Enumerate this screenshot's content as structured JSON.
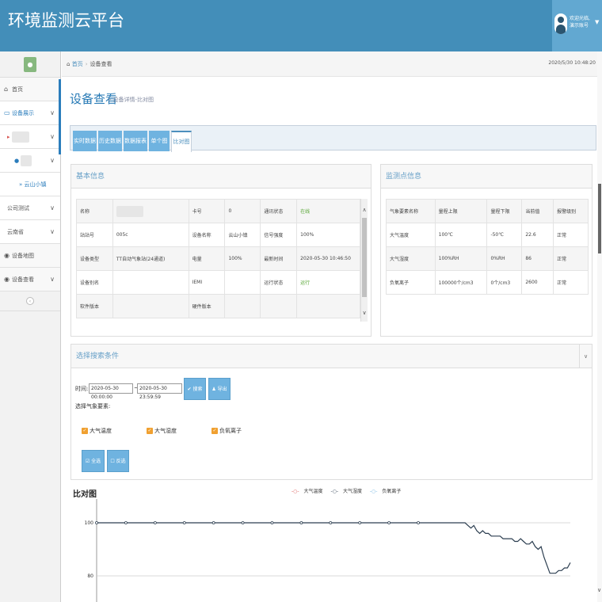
{
  "app": {
    "title": "环境监测云平台"
  },
  "user": {
    "welcome": "欢迎光临,",
    "name": "演示账号"
  },
  "breadcrumb": {
    "home": "首页",
    "current": "设备查看",
    "time": "2020/5/30 10:48:20"
  },
  "sidebar": {
    "items": [
      {
        "label": "首页",
        "icon": "home-icon"
      },
      {
        "label": "设备展示",
        "icon": "monitor-icon"
      },
      {
        "label": "公司测试"
      },
      {
        "label": "云南省"
      },
      {
        "label": "设备地图",
        "icon": "map-icon"
      },
      {
        "label": "设备查看",
        "icon": "eye-icon"
      }
    ],
    "leaf": "云山小镇"
  },
  "page": {
    "title": "设备查看",
    "subtitle": "设备详情-比对图"
  },
  "tabs": [
    "实时数据",
    "历史数据",
    "数据报表",
    "单个图",
    "比对图"
  ],
  "basic": {
    "title": "基本信息",
    "rows": [
      [
        "名称",
        "",
        "卡号",
        "0",
        "通讯状态",
        "在线"
      ],
      [
        "站站号",
        "005c",
        "设备名称",
        "云山小镇",
        "信号强度",
        "100%"
      ],
      [
        "设备类型",
        "TT自动气象站(24通道)",
        "电量",
        "100%",
        "最新时间",
        "2020-05-30 10:46:50"
      ],
      [
        "设备别名",
        "",
        "IEMI",
        "",
        "运行状态",
        "运行"
      ],
      [
        "软件版本",
        "",
        "硬件版本",
        "",
        "",
        ""
      ]
    ]
  },
  "monitor": {
    "title": "监测点信息",
    "headers": [
      "气象要素名称",
      "量程上限",
      "量程下限",
      "当前值",
      "报警级别"
    ],
    "rows": [
      [
        "大气温度",
        "100℃",
        "-50℃",
        "22.6",
        "正常"
      ],
      [
        "大气湿度",
        "100%RH",
        "0%RH",
        "86",
        "正常"
      ],
      [
        "负氧离子",
        "100000个/cm3",
        "0个/cm3",
        "2600",
        "正常"
      ]
    ]
  },
  "search": {
    "title": "选择搜索条件",
    "time_label": "时间:",
    "from": "2020-05-30 00:00:00",
    "to": "2020-05-30 23:59:59",
    "tilde": "~",
    "search_btn": "搜索",
    "export_btn": "导出",
    "elements_label": "选择气象要素:",
    "options": [
      "大气温度",
      "大气湿度",
      "负氧离子"
    ],
    "select_all": "全选",
    "reverse": "反选"
  },
  "chart_data": {
    "type": "line",
    "title": "比对图",
    "series": [
      {
        "name": "大气温度"
      },
      {
        "name": "大气湿度",
        "y": [
          100,
          100,
          100,
          100,
          100,
          100,
          100,
          100,
          100,
          100,
          100,
          100,
          100,
          100,
          100,
          100,
          100,
          100,
          100,
          100,
          100,
          100,
          100,
          100,
          100,
          100,
          100,
          100,
          100,
          100,
          100,
          100,
          100,
          100,
          100,
          100,
          100,
          100,
          100,
          100,
          100,
          100,
          100,
          100,
          100,
          100,
          100,
          100,
          100,
          100,
          100,
          100,
          100,
          100,
          100,
          100,
          100,
          100,
          100,
          100,
          100,
          100,
          100,
          100,
          100,
          100,
          100,
          100,
          100,
          100,
          100,
          100,
          100,
          100,
          100,
          100,
          100,
          100,
          100,
          100,
          100,
          100,
          100,
          100,
          100,
          100,
          100,
          100,
          100,
          100,
          100,
          100,
          100,
          100,
          100,
          100,
          100,
          100,
          100,
          100,
          100,
          100,
          100,
          100,
          100,
          100,
          100,
          100,
          100,
          100,
          100,
          100,
          100,
          100,
          100,
          100,
          100,
          100,
          100,
          100,
          100,
          100,
          100,
          100,
          100,
          100,
          100,
          99,
          98,
          99,
          97,
          96,
          97,
          96,
          96,
          95,
          95,
          95,
          95,
          94,
          94,
          94,
          94,
          93,
          93,
          94,
          93,
          92,
          92,
          93,
          91,
          90,
          91,
          87,
          84,
          81,
          81,
          81,
          82,
          82,
          83,
          83,
          85
        ]
      },
      {
        "name": "负氧离子"
      }
    ],
    "yticks": [
      100,
      80
    ],
    "ylim": [
      76,
      102
    ],
    "colors": {
      "temp": "#d9534f",
      "hum": "#2c3e50",
      "ion": "#6fb3e0"
    }
  }
}
